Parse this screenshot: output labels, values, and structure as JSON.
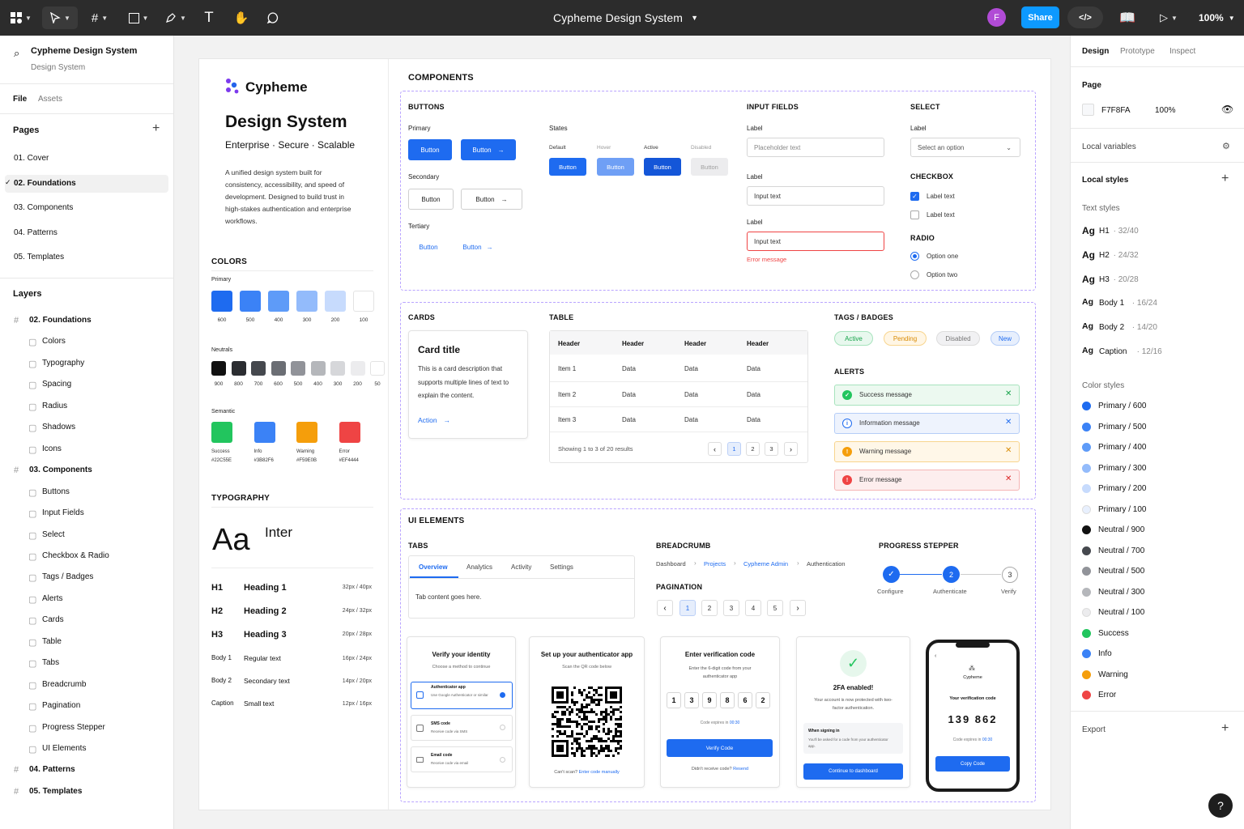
{
  "toolbar": {
    "file_title": "Cypheme Design System",
    "avatar_initial": "F",
    "share_label": "Share",
    "zoom": "100%",
    "accent": "#0d99ff"
  },
  "left_panel": {
    "project_name": "Cypheme Design System",
    "project_sub": "Design System",
    "tabs": [
      "File",
      "Assets"
    ],
    "pages_title": "Pages",
    "pages": [
      "01. Cover",
      "02. Foundations",
      "03. Components",
      "04. Patterns",
      "05. Templates"
    ],
    "layers_title": "Layers",
    "layers": [
      {
        "label": "02. Foundations",
        "type": "frame"
      },
      {
        "label": "Colors",
        "type": "child"
      },
      {
        "label": "Typography",
        "type": "child"
      },
      {
        "label": "Spacing",
        "type": "child"
      },
      {
        "label": "Radius",
        "type": "child"
      },
      {
        "label": "Shadows",
        "type": "child"
      },
      {
        "label": "Icons",
        "type": "child"
      },
      {
        "label": "03. Components",
        "type": "frame"
      },
      {
        "label": "Buttons",
        "type": "child"
      },
      {
        "label": "Input Fields",
        "type": "child"
      },
      {
        "label": "Select",
        "type": "child"
      },
      {
        "label": "Checkbox & Radio",
        "type": "child"
      },
      {
        "label": "Tags / Badges",
        "type": "child"
      },
      {
        "label": "Alerts",
        "type": "child"
      },
      {
        "label": "Cards",
        "type": "child"
      },
      {
        "label": "Table",
        "type": "child"
      },
      {
        "label": "Tabs",
        "type": "child"
      },
      {
        "label": "Breadcrumb",
        "type": "child"
      },
      {
        "label": "Pagination",
        "type": "child"
      },
      {
        "label": "Progress Stepper",
        "type": "child"
      },
      {
        "label": "UI Elements",
        "type": "child"
      },
      {
        "label": "04. Patterns",
        "type": "frame"
      },
      {
        "label": "05. Templates",
        "type": "frame"
      }
    ]
  },
  "brand": {
    "logo_text": "Cypheme",
    "title": "Design System",
    "tagline": "Enterprise · Secure · Scalable",
    "description": "A unified design system built for consistency, accessibility, and speed of development. Designed to build trust in high-stakes authentication and enterprise workflows."
  },
  "colors": {
    "title": "COLORS",
    "primary_label": "Primary",
    "primary": [
      {
        "label": "600",
        "hex": "#1e6bf0"
      },
      {
        "label": "500",
        "hex": "#3b82f6"
      },
      {
        "label": "400",
        "hex": "#5e9bf8"
      },
      {
        "label": "300",
        "hex": "#93bbfb"
      },
      {
        "label": "200",
        "hex": "#c7dbfd"
      },
      {
        "label": "100",
        "hex": "#ffffff"
      }
    ],
    "neutrals_label": "Neutrals",
    "neutrals": [
      {
        "label": "900",
        "hex": "#111111"
      },
      {
        "label": "800",
        "hex": "#2b2d31"
      },
      {
        "label": "700",
        "hex": "#45484e"
      },
      {
        "label": "600",
        "hex": "#6b6e74"
      },
      {
        "label": "500",
        "hex": "#919399"
      },
      {
        "label": "400",
        "hex": "#b5b7bb"
      },
      {
        "label": "300",
        "hex": "#d6d7da"
      },
      {
        "label": "200",
        "hex": "#ececee"
      },
      {
        "label": "50",
        "hex": "#ffffff"
      }
    ],
    "semantic_label": "Semantic",
    "semantic": [
      {
        "name": "Success",
        "code": "#22C55E",
        "hex": "#22c55e"
      },
      {
        "name": "Info",
        "code": "#3B82F6",
        "hex": "#3b82f6"
      },
      {
        "name": "Warning",
        "code": "#F59E0B",
        "hex": "#f59e0b"
      },
      {
        "name": "Error",
        "code": "#EF4444",
        "hex": "#ef4444"
      }
    ]
  },
  "typography": {
    "title": "TYPOGRAPHY",
    "sample": "Aa",
    "font_name": "Inter",
    "scale": [
      {
        "tag": "H1",
        "name": "Heading 1",
        "size": "32px / 40px"
      },
      {
        "tag": "H2",
        "name": "Heading 2",
        "size": "24px / 32px"
      },
      {
        "tag": "H3",
        "name": "Heading 3",
        "size": "20px / 28px"
      },
      {
        "tag": "Body 1",
        "name": "Regular text",
        "size": "16px / 24px"
      },
      {
        "tag": "Body 2",
        "name": "Secondary text",
        "size": "14px / 20px"
      },
      {
        "tag": "Caption",
        "name": "Small text",
        "size": "12px / 16px"
      }
    ]
  },
  "components": {
    "title": "COMPONENTS",
    "buttons": {
      "title": "BUTTONS",
      "primary": "Primary",
      "secondary": "Secondary",
      "tertiary": "Tertiary",
      "states": "States",
      "label": "Button",
      "state_labels": [
        "Default",
        "Hover",
        "Active",
        "Disabled"
      ]
    },
    "inputs": {
      "title": "INPUT FIELDS",
      "label": "Label",
      "placeholder": "Placeholder text",
      "value": "Input text",
      "error": "Error message"
    },
    "select": {
      "title": "SELECT",
      "label": "Label",
      "placeholder": "Select an option"
    },
    "checkbox": {
      "title": "CHECKBOX",
      "items": [
        "Label text",
        "Label text"
      ]
    },
    "radio": {
      "title": "RADIO",
      "items": [
        "Option one",
        "Option two"
      ]
    },
    "cards": {
      "title": "CARDS",
      "card_title": "Card title",
      "card_desc": "This is a card description that supports multiple lines of text to explain the content.",
      "action": "Action"
    },
    "table": {
      "title": "TABLE",
      "headers": [
        "Header",
        "Header",
        "Header",
        "Header"
      ],
      "rows": [
        [
          "Item 1",
          "Data",
          "Data",
          "Data"
        ],
        [
          "Item 2",
          "Data",
          "Data",
          "Data"
        ],
        [
          "Item 3",
          "Data",
          "Data",
          "Data"
        ]
      ],
      "footer": "Showing 1 to 3 of 20 results",
      "pages": [
        "1",
        "2",
        "3"
      ]
    },
    "tags": {
      "title": "TAGS / BADGES",
      "items": [
        "Active",
        "Pending",
        "Disabled",
        "New"
      ]
    },
    "alerts": {
      "title": "ALERTS",
      "items": [
        "Success message",
        "Information message",
        "Warning message",
        "Error message"
      ]
    }
  },
  "ui_elements": {
    "title": "UI ELEMENTS",
    "tabs": {
      "title": "TABS",
      "items": [
        "Overview",
        "Analytics",
        "Activity",
        "Settings"
      ],
      "content": "Tab content goes here."
    },
    "breadcrumb": {
      "title": "BREADCRUMB",
      "items": [
        "Dashboard",
        "Projects",
        "Cypheme Admin",
        "Authentication"
      ]
    },
    "pagination": {
      "title": "PAGINATION",
      "pages": [
        "1",
        "2",
        "3",
        "4",
        "5"
      ]
    },
    "stepper": {
      "title": "PROGRESS STEPPER",
      "steps": [
        "Configure",
        "Authenticate",
        "Verify"
      ],
      "numbers": [
        "2",
        "3"
      ]
    },
    "screens": {
      "verify": {
        "title": "Verify your identity",
        "subtitle": "Choose a method to continue",
        "methods": [
          {
            "name": "Authenticator app",
            "desc": "Use Google Authenticator or similar"
          },
          {
            "name": "SMS code",
            "desc": "Receive code via SMS"
          },
          {
            "name": "Email code",
            "desc": "Receive code via email"
          }
        ]
      },
      "setup": {
        "title": "Set up your authenticator app",
        "subtitle": "Scan the QR code below",
        "cant_scan": "Can't scan?",
        "manual": "Enter code manually"
      },
      "code": {
        "title": "Enter verification code",
        "subtitle": "Enter the 6-digit code from your authenticator app",
        "digits": [
          "1",
          "3",
          "9",
          "8",
          "6",
          "2"
        ],
        "expires": "Code expires in",
        "time": "00:30",
        "button": "Verify Code",
        "resend_q": "Didn't receive code?",
        "resend": "Resend"
      },
      "enabled": {
        "title": "2FA enabled!",
        "desc": "Your account is now protected with two-factor authentication.",
        "note_title": "When signing in",
        "note": "You'll be asked for a code from your authenticator app.",
        "button": "Continue to dashboard"
      },
      "phone": {
        "brand": "Cypheme",
        "label": "Your verification code",
        "code": "139 862",
        "expires": "Code expires in",
        "time": "00:30",
        "button": "Copy Code"
      }
    }
  },
  "right_panel": {
    "tabs": [
      "Design",
      "Prototype",
      "Inspect"
    ],
    "page_title": "Page",
    "page_color": "F7F8FA",
    "page_opacity": "100%",
    "local_variables": "Local variables",
    "local_styles": "Local styles",
    "text_styles_title": "Text styles",
    "text_styles": [
      {
        "name": "H1",
        "spec": "32/40"
      },
      {
        "name": "H2",
        "spec": "24/32"
      },
      {
        "name": "H3",
        "spec": "20/28"
      },
      {
        "name": "Body 1",
        "spec": "16/24"
      },
      {
        "name": "Body 2",
        "spec": "14/20"
      },
      {
        "name": "Caption",
        "spec": "12/16"
      }
    ],
    "ag": "Ag",
    "color_styles_title": "Color styles",
    "color_styles": [
      {
        "name": "Primary / 600",
        "hex": "#1e6bf0"
      },
      {
        "name": "Primary / 500",
        "hex": "#3b82f6"
      },
      {
        "name": "Primary / 400",
        "hex": "#5e9bf8"
      },
      {
        "name": "Primary / 300",
        "hex": "#93bbfb"
      },
      {
        "name": "Primary / 200",
        "hex": "#c7dbfd"
      },
      {
        "name": "Primary / 100",
        "hex": "#e8f0fe"
      },
      {
        "name": "Neutral / 900",
        "hex": "#111111"
      },
      {
        "name": "Neutral / 700",
        "hex": "#45484e"
      },
      {
        "name": "Neutral / 500",
        "hex": "#919399"
      },
      {
        "name": "Neutral / 300",
        "hex": "#b5b7bb"
      },
      {
        "name": "Neutral / 100",
        "hex": "#ececee"
      },
      {
        "name": "Success",
        "hex": "#22c55e"
      },
      {
        "name": "Info",
        "hex": "#3b82f6"
      },
      {
        "name": "Warning",
        "hex": "#f59e0b"
      },
      {
        "name": "Error",
        "hex": "#ef4444"
      }
    ],
    "export": "Export",
    "help": "?"
  }
}
